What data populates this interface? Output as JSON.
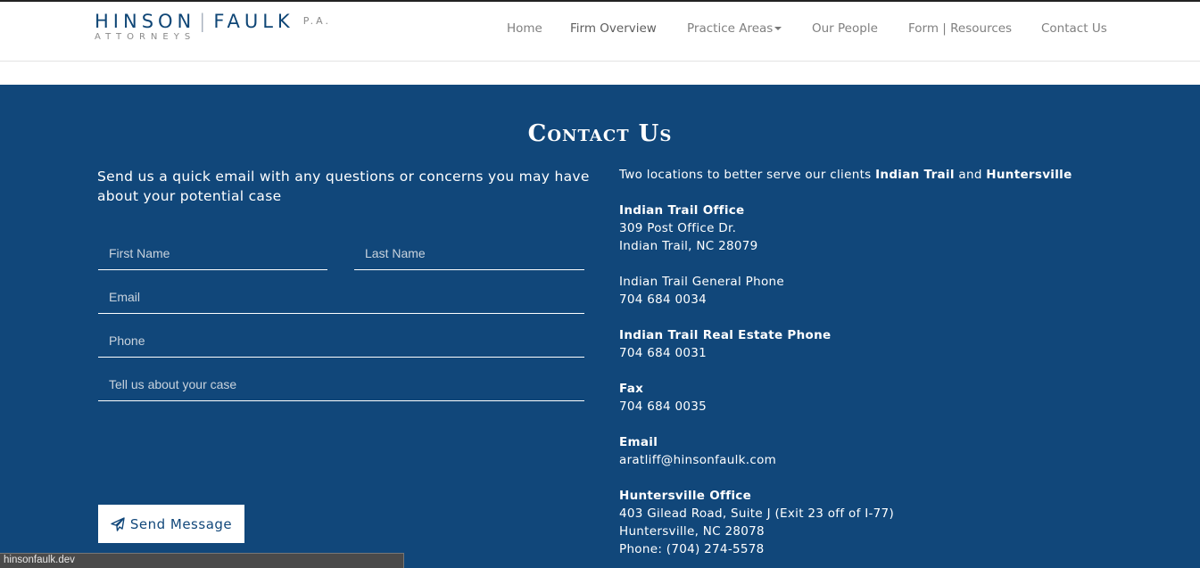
{
  "header": {
    "logo": {
      "name_left": "HINSON",
      "separator": "|",
      "name_right": "FAULK",
      "suffix": "P.A.",
      "subtitle": "ATTORNEYS"
    },
    "nav": {
      "home": "Home",
      "firm_overview": "Firm Overview",
      "practice_areas": "Practice Areas",
      "our_people": "Our People",
      "forms_resources": "Form | Resources",
      "contact_us": "Contact Us"
    }
  },
  "contact": {
    "title": "Contact Us",
    "intro": "Send us a quick email with any questions or concerns you may have about your potential case",
    "form": {
      "first_name_placeholder": "First Name",
      "last_name_placeholder": "Last Name",
      "email_placeholder": "Email",
      "phone_placeholder": "Phone",
      "case_placeholder": "Tell us about your case",
      "send_label": "Send Message"
    },
    "info": {
      "locations_prefix": "Two locations to better serve our clients ",
      "location_1": "Indian Trail",
      "locations_and": " and ",
      "location_2": "Huntersville",
      "indian_trail_heading": "Indian Trail Office",
      "indian_trail_address_1": "309 Post Office Dr.",
      "indian_trail_address_2": "Indian Trail, NC 28079",
      "general_phone_label": "Indian Trail General Phone",
      "general_phone": "704 684 0034",
      "real_estate_phone_label": "Indian Trail Real Estate Phone",
      "real_estate_phone": "704 684 0031",
      "fax_label": "Fax",
      "fax": "704 684 0035",
      "email_label": "Email",
      "email": "aratliff@hinsonfaulk.com",
      "huntersville_heading": "Huntersville Office",
      "huntersville_address_1": "403 Gilead Road, Suite J (Exit 23 off of I-77)",
      "huntersville_address_2": "Huntersville, NC 28078",
      "huntersville_phone": "Phone: (704) 274-5578"
    }
  },
  "status_bar": {
    "url": "hinsonfaulk.dev"
  },
  "colors": {
    "brand_blue": "#11477a",
    "logo_blue": "#0f4676"
  },
  "icons": {
    "send": "paper-plane-icon"
  }
}
